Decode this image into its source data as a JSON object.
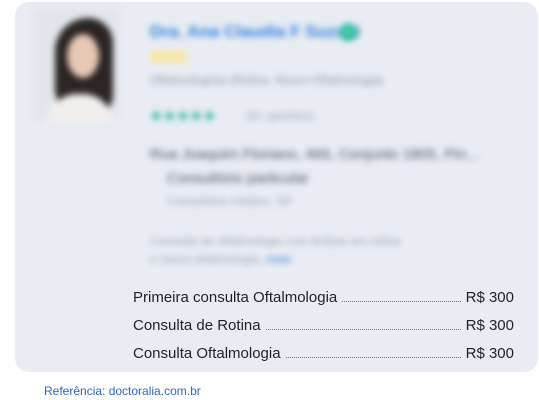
{
  "card": {
    "name": "Dra. Ana Claudia F Suzuki",
    "specialty": "Oftalmologista (Retina, Neuro-Oftalmologia)",
    "stars": "★★★★★",
    "reviews": "(41 opiniões)",
    "address_line1": "Rua Joaquim Floriano, 466, Conjunto 1805, Pin...",
    "address_line2": "Consultório particular",
    "address_line3": "Consultório médico, SP",
    "description_line1": "Consulta de oftalmologia com ênfase em retina",
    "description_line2": "e neuro-oftalmologia,",
    "description_more": "mais"
  },
  "prices": [
    {
      "label": "Primeira consulta Oftalmologia",
      "price": "R$ 300"
    },
    {
      "label": "Consulta de Rotina",
      "price": "R$ 300"
    },
    {
      "label": "Consulta Oftalmologia",
      "price": "R$ 300"
    }
  ],
  "reference": "Referência: doctoralia.com.br"
}
